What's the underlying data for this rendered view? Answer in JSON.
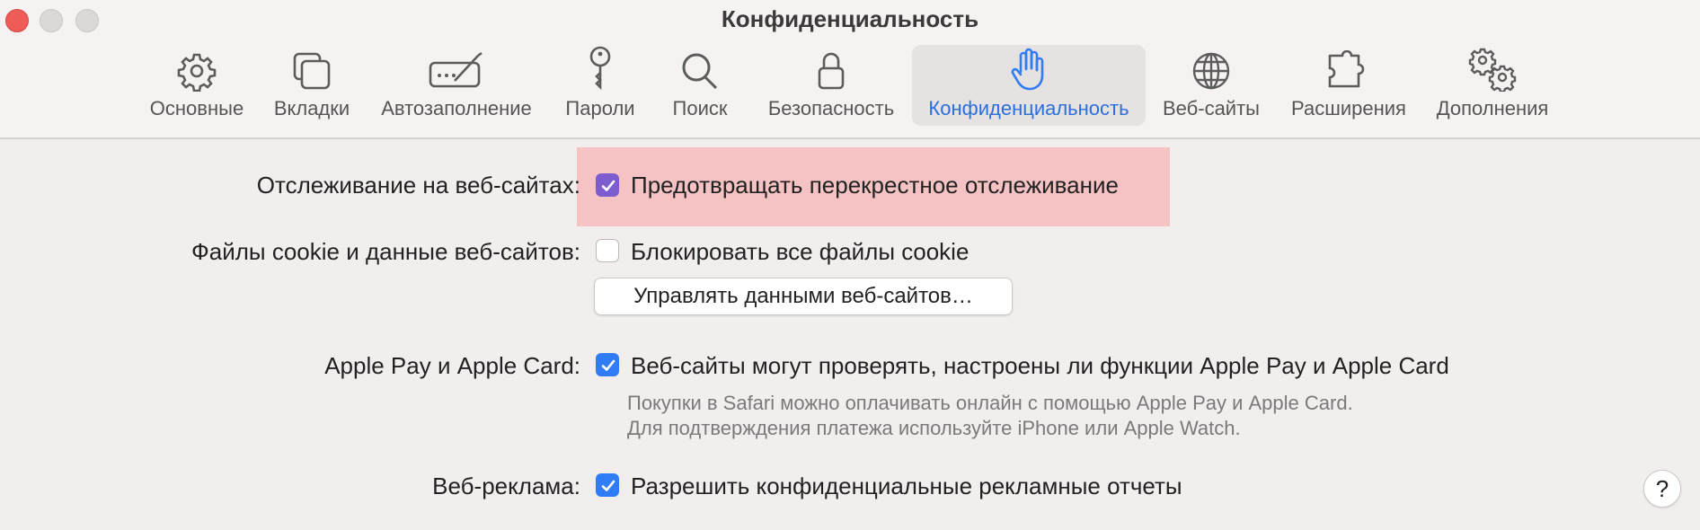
{
  "window": {
    "title": "Конфиденциальность",
    "traffic_lights": [
      "close",
      "minimize",
      "zoom"
    ]
  },
  "tabs": [
    {
      "label": "Основные",
      "icon": "gear-icon"
    },
    {
      "label": "Вкладки",
      "icon": "tabs-icon"
    },
    {
      "label": "Автозаполнение",
      "icon": "autofill-icon"
    },
    {
      "label": "Пароли",
      "icon": "key-icon"
    },
    {
      "label": "Поиск",
      "icon": "search-icon"
    },
    {
      "label": "Безопасность",
      "icon": "lock-icon"
    },
    {
      "label": "Конфиденциальность",
      "icon": "hand-icon",
      "selected": true
    },
    {
      "label": "Веб-сайты",
      "icon": "globe-icon"
    },
    {
      "label": "Расширения",
      "icon": "puzzle-icon"
    },
    {
      "label": "Дополнения",
      "icon": "gears-icon"
    }
  ],
  "settings": {
    "tracking": {
      "label": "Отслеживание на веб-сайтах:",
      "option": "Предотвращать перекрестное отслеживание",
      "checked": true,
      "highlighted": true
    },
    "cookies": {
      "label": "Файлы cookie и данные веб-сайтов:",
      "option": "Блокировать все файлы cookie",
      "checked": false,
      "button": "Управлять данными веб-сайтов…"
    },
    "apple_pay": {
      "label": "Apple Pay и Apple Card:",
      "option": "Веб-сайты могут проверять, настроены ли функции Apple Pay и Apple Card",
      "checked": true,
      "note_line1": "Покупки в Safari можно оплачивать онлайн с помощью Apple Pay и Apple Card.",
      "note_line2": "Для подтверждения платежа используйте iPhone или Apple Watch."
    },
    "ads": {
      "label": "Веб-реклама:",
      "option": "Разрешить конфиденциальные рекламные отчеты",
      "checked": true
    }
  },
  "help": {
    "label": "?"
  },
  "colors": {
    "accent": "#2f7cf6",
    "selected_tab_text": "#2a6fdb",
    "highlight": "#f5c3c3",
    "tracking_checkbox": "#7d5ccf"
  }
}
